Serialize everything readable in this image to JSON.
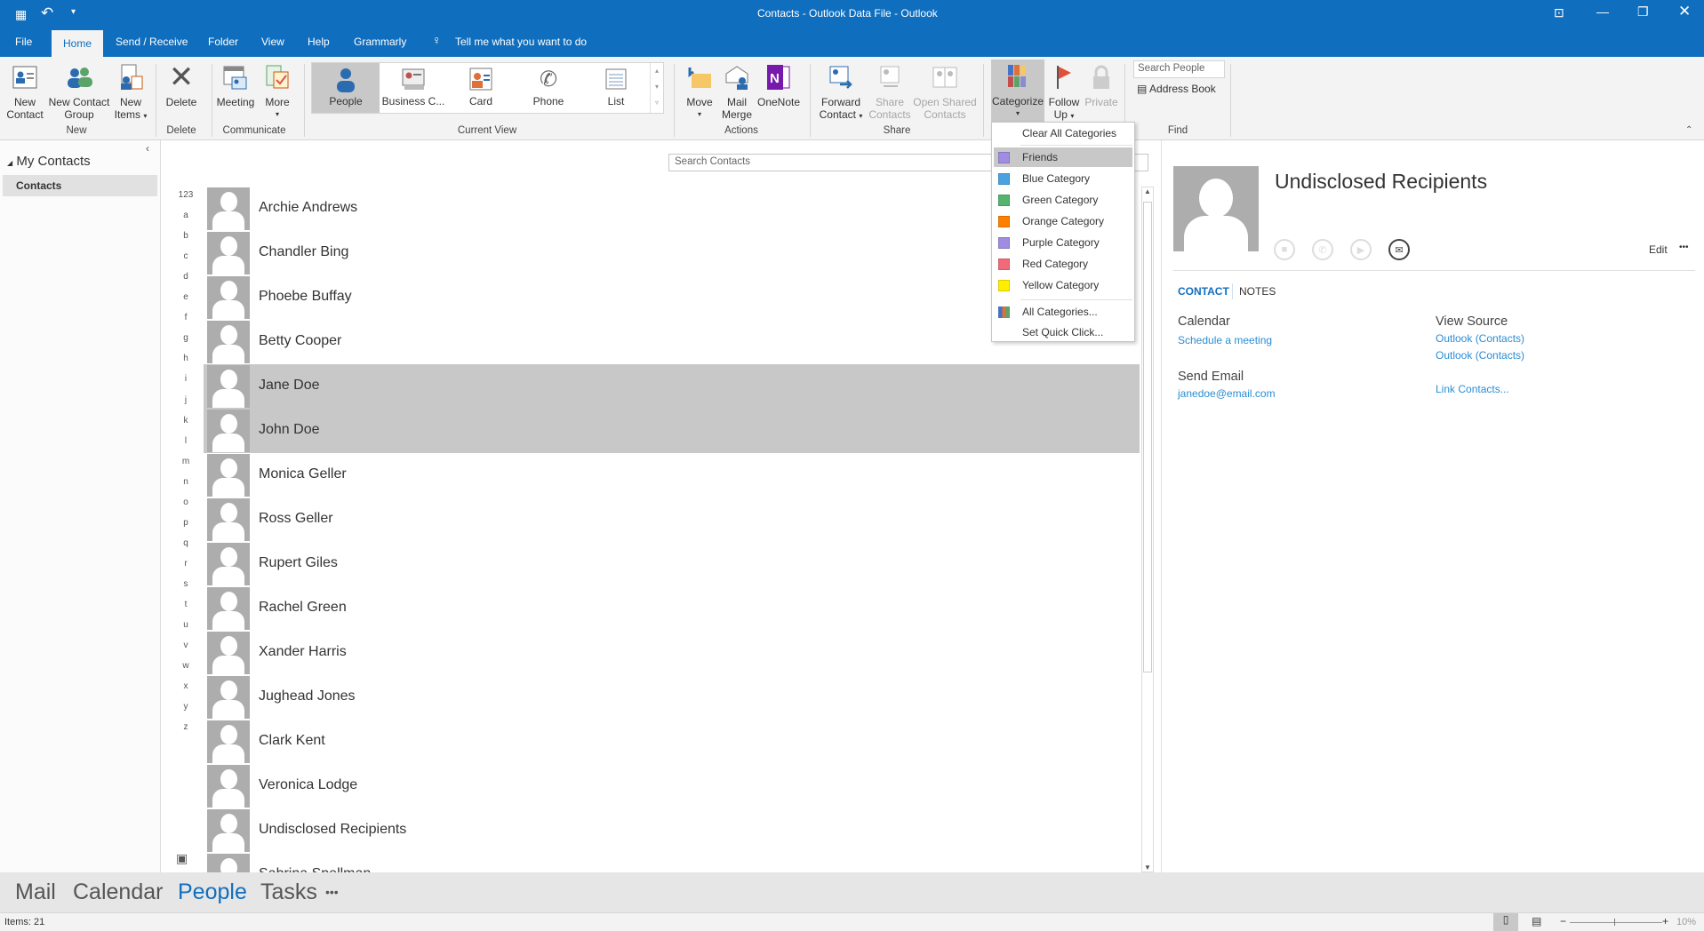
{
  "window": {
    "title": "Contacts - Outlook Data File  -  Outlook"
  },
  "menu_tabs": [
    "File",
    "Home",
    "Send / Receive",
    "Folder",
    "View",
    "Help",
    "Grammarly"
  ],
  "tell_me": "Tell me what you want to do",
  "ribbon": {
    "new_contact": [
      "New",
      "Contact"
    ],
    "new_contact_group": [
      "New Contact",
      "Group"
    ],
    "new_items": [
      "New",
      "Items"
    ],
    "group_new": "New",
    "delete": "Delete",
    "group_delete": "Delete",
    "meeting": "Meeting",
    "more": "More",
    "group_communicate": "Communicate",
    "views": [
      "People",
      "Business C...",
      "Card",
      "Phone",
      "List"
    ],
    "selected_view": "People",
    "group_current_view": "Current View",
    "move": "Move",
    "mail_merge": [
      "Mail",
      "Merge"
    ],
    "onenote": "OneNote",
    "group_actions": "Actions",
    "forward_contact": [
      "Forward",
      "Contact"
    ],
    "share_contacts": [
      "Share",
      "Contacts"
    ],
    "open_shared_contacts": [
      "Open Shared",
      "Contacts"
    ],
    "group_share": "Share",
    "categorize": "Categorize",
    "follow_up": [
      "Follow",
      "Up"
    ],
    "private": "Private",
    "search_people_placeholder": "Search People",
    "address_book": "Address Book",
    "group_find": "Find"
  },
  "categorize_menu": {
    "clear_all": "Clear All Categories",
    "categories": [
      {
        "label": "Friends",
        "color": "#a08ce0",
        "highlighted": true
      },
      {
        "label": "Blue Category",
        "color": "#4aa3e0"
      },
      {
        "label": "Green Category",
        "color": "#55b46e"
      },
      {
        "label": "Orange Category",
        "color": "#ff8000"
      },
      {
        "label": "Purple Category",
        "color": "#a08ce0"
      },
      {
        "label": "Red Category",
        "color": "#f06a7a"
      },
      {
        "label": "Yellow Category",
        "color": "#ffee00"
      }
    ],
    "all_categories": "All Categories...",
    "set_quick_click": "Set Quick Click..."
  },
  "folder_pane": {
    "group": "My Contacts",
    "folder": "Contacts"
  },
  "search_contacts_placeholder": "Search Contacts",
  "alphabet": [
    "123",
    "a",
    "b",
    "c",
    "d",
    "e",
    "f",
    "g",
    "h",
    "i",
    "j",
    "k",
    "l",
    "m",
    "n",
    "o",
    "p",
    "q",
    "r",
    "s",
    "t",
    "u",
    "v",
    "w",
    "x",
    "y",
    "z"
  ],
  "contacts": [
    {
      "name": "Archie Andrews"
    },
    {
      "name": "Chandler Bing"
    },
    {
      "name": "Phoebe Buffay"
    },
    {
      "name": "Betty Cooper"
    },
    {
      "name": "Jane Doe",
      "selected": true
    },
    {
      "name": "John Doe",
      "selected": true
    },
    {
      "name": "Monica Geller"
    },
    {
      "name": "Ross Geller"
    },
    {
      "name": "Rupert Giles"
    },
    {
      "name": "Rachel Green"
    },
    {
      "name": "Xander Harris"
    },
    {
      "name": "Jughead Jones"
    },
    {
      "name": "Clark Kent"
    },
    {
      "name": "Veronica Lodge"
    },
    {
      "name": "Undisclosed Recipients"
    },
    {
      "name": "Sabrina Spellman"
    }
  ],
  "reading_pane": {
    "name": "Undisclosed Recipients",
    "edit": "Edit",
    "more": "•••",
    "tabs": [
      "CONTACT",
      "NOTES"
    ],
    "calendar_label": "Calendar",
    "schedule_meeting": "Schedule a meeting",
    "send_email_label": "Send Email",
    "email": "janedoe@email.com",
    "view_source_label": "View Source",
    "sources": [
      "Outlook (Contacts)",
      "Outlook (Contacts)"
    ],
    "link_contacts": "Link Contacts..."
  },
  "nav": {
    "items": [
      "Mail",
      "Calendar",
      "People",
      "Tasks"
    ],
    "active": "People",
    "more": "•••"
  },
  "status": {
    "items": "Items: 21",
    "zoom": "10%"
  },
  "colors": {
    "accent": "#106ebe",
    "selection": "#c8c8c8",
    "link": "#2a8dd4"
  }
}
